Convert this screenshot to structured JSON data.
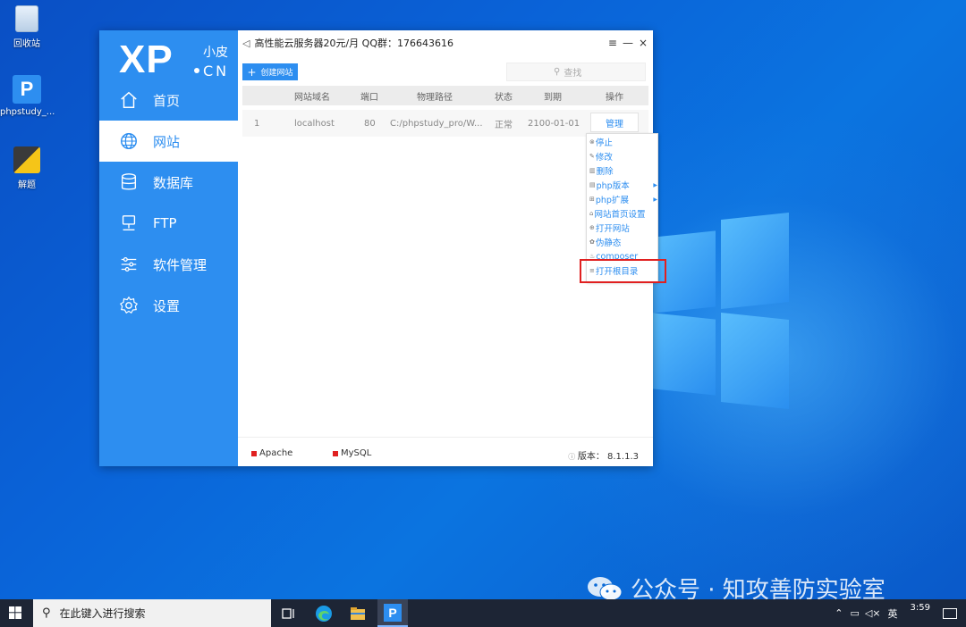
{
  "desktop": {
    "icons": [
      {
        "label": "回收站",
        "icon": "recycle-bin-icon"
      },
      {
        "label": "phpstudy_...",
        "icon": "phpstudy-shortcut-icon"
      },
      {
        "label": "解题",
        "icon": "python-file-icon"
      }
    ]
  },
  "app": {
    "logo": {
      "main": "XP",
      "cn_top": "小皮",
      "cn_bottom": "CN"
    },
    "nav": [
      {
        "label": "首页",
        "icon": "home-icon"
      },
      {
        "label": "网站",
        "icon": "globe-icon"
      },
      {
        "label": "数据库",
        "icon": "database-icon"
      },
      {
        "label": "FTP",
        "icon": "ftp-icon"
      },
      {
        "label": "软件管理",
        "icon": "sliders-icon"
      },
      {
        "label": "设置",
        "icon": "gear-icon"
      }
    ],
    "active_nav": "网站",
    "title": "高性能云服务器20元/月  QQ群：176643616",
    "window_controls": [
      "≡",
      "—",
      "×"
    ],
    "create_button": "创建网站",
    "search_placeholder": "查找",
    "table": {
      "headers": [
        "网站域名",
        "端口",
        "物理路径",
        "状态",
        "到期",
        "操作"
      ],
      "rows": [
        {
          "index": "1",
          "domain": "localhost",
          "port": "80",
          "path": "C:/phpstudy_pro/W...",
          "status": "正常",
          "expire": "2100-01-01",
          "action": "管理"
        }
      ]
    },
    "context_menu": [
      {
        "icon": "stop-icon",
        "glyph": "⊗",
        "label": "停止",
        "submenu": false
      },
      {
        "icon": "edit-icon",
        "glyph": "✎",
        "label": "修改",
        "submenu": false
      },
      {
        "icon": "trash-icon",
        "glyph": "▥",
        "label": "删除",
        "submenu": false
      },
      {
        "icon": "php-version-icon",
        "glyph": "▤",
        "label": "php版本",
        "submenu": true
      },
      {
        "icon": "php-extension-icon",
        "glyph": "⊞",
        "label": "php扩展",
        "submenu": true
      },
      {
        "icon": "homepage-settings-icon",
        "glyph": "⌂",
        "label": "网站首页设置",
        "submenu": false
      },
      {
        "icon": "open-site-icon",
        "glyph": "⊕",
        "label": "打开网站",
        "submenu": false
      },
      {
        "icon": "rewrite-icon",
        "glyph": "✿",
        "label": "伪静态",
        "submenu": false
      },
      {
        "icon": "composer-icon",
        "glyph": "♨",
        "label": "composer",
        "submenu": false
      },
      {
        "icon": "folder-open-icon",
        "glyph": "≡",
        "label": "打开根目录",
        "submenu": false
      }
    ],
    "footer": {
      "services": [
        "Apache",
        "MySQL"
      ],
      "service_status_color": "#e02020",
      "version": "版本：  8.1.1.3"
    }
  },
  "watermark": "公众号 · 知攻善防实验室",
  "taskbar": {
    "search_placeholder": "在此键入进行搜索",
    "apps": [
      "task-view-icon",
      "edge-icon",
      "file-explorer-icon",
      "phpstudy-taskbar-icon"
    ],
    "tray": {
      "ime": "英",
      "time": "3:59"
    }
  },
  "colors": {
    "accent": "#2d8ef0",
    "highlight": "#e02020"
  }
}
